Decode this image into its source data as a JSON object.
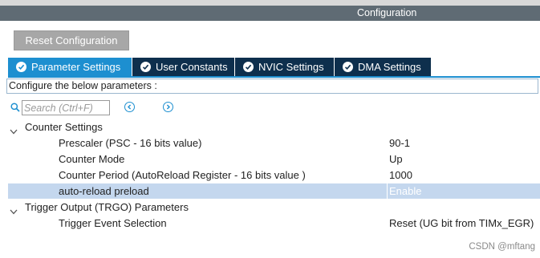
{
  "window": {
    "title": "Configuration"
  },
  "toolbar": {
    "reset_label": "Reset Configuration"
  },
  "tabs": [
    {
      "label": "Parameter Settings",
      "active": true
    },
    {
      "label": "User Constants",
      "active": false
    },
    {
      "label": "NVIC Settings",
      "active": false
    },
    {
      "label": "DMA Settings",
      "active": false
    }
  ],
  "instructions": "Configure the below parameters :",
  "search": {
    "placeholder": "Search (Ctrl+F)",
    "value": ""
  },
  "groups": [
    {
      "label": "Counter Settings",
      "expanded": true,
      "params": [
        {
          "label": "Prescaler (PSC - 16 bits value)",
          "value": "90-1",
          "selected": false
        },
        {
          "label": "Counter Mode",
          "value": "Up",
          "selected": false
        },
        {
          "label": "Counter Period (AutoReload Register - 16 bits value )",
          "value": "1000",
          "selected": false
        },
        {
          "label": "auto-reload preload",
          "value": "Enable",
          "selected": true
        }
      ]
    },
    {
      "label": "Trigger Output (TRGO) Parameters",
      "expanded": true,
      "params": [
        {
          "label": "Trigger Event Selection",
          "value": "Reset (UG bit from TIMx_EGR)",
          "selected": false
        }
      ]
    }
  ],
  "watermark": "CSDN @mftang",
  "colors": {
    "title_bar": "#5f6b74",
    "tab_active": "#1d8fd0",
    "tab_inactive": "#0e2f4d",
    "selected_row": "#c4d7ee",
    "reset_button": "#a7a7a7"
  },
  "icons": {
    "tab": "check-circle-icon",
    "search": "search-icon",
    "nav_prev": "chevron-left-circle-icon",
    "nav_next": "chevron-right-circle-icon",
    "group": "chevron-down-icon"
  }
}
